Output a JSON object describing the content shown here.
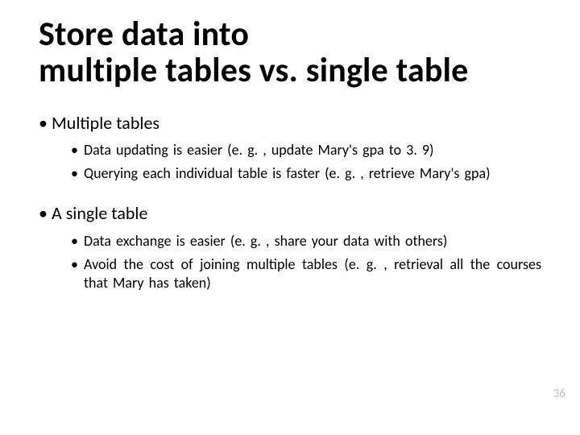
{
  "title_line1": "Store data into",
  "title_line2": "multiple  tables vs. single table",
  "sections": [
    {
      "heading": "Multiple  tables",
      "items": [
        "Data updating is easier (e. g. , update Mary's gpa to 3. 9)",
        "Querying each individual table is  faster  (e. g. ,  retrieve Mary's  gpa)"
      ]
    },
    {
      "heading": "A single  table",
      "items": [
        "Data exchange is easier (e. g. , share your data with others)",
        "Avoid the cost of joining multiple tables (e. g. ,  retrieval  all  the  courses  that  Mary  has  taken)"
      ]
    }
  ],
  "page_number": "36"
}
